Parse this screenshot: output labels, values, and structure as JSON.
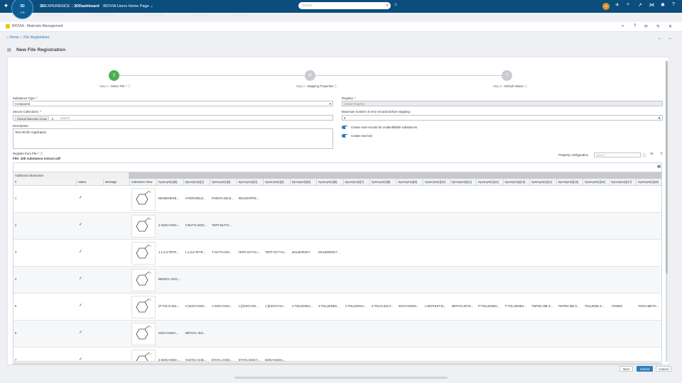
{
  "topbar": {
    "compass_label": "3D",
    "version": "V.R",
    "brand_prefix": "3D",
    "brand_experience": "EXPERIENCE",
    "brand_sep": "|",
    "brand_app": "3DDashboard",
    "dashboard_title": "BIOVIA Users Home Page",
    "search_placeholder": "Search",
    "avatar_initials": "JK",
    "ghost_tabs": [
      "BIOVIA Materials",
      "Getting Started",
      "Sample Data",
      "My Apps",
      "Favorites"
    ]
  },
  "app": {
    "title": "BIOVIA - Materials Management"
  },
  "breadcrumb": {
    "home": "Home",
    "sep": "›",
    "current": "File Registration"
  },
  "page": {
    "title": "New File Registration"
  },
  "steps": [
    {
      "num": "Step 1",
      "label": "Select File *",
      "icon": "file-icon",
      "state": "active"
    },
    {
      "num": "Step 2",
      "label": "Mapping Properties",
      "icon": "mapping-icon",
      "state": "pending"
    },
    {
      "num": "Step 3",
      "label": "Default Values",
      "icon": "default-values-icon",
      "state": "pending"
    }
  ],
  "form": {
    "substance_type_label": "Substance Type:",
    "substance_type_value": "Compound",
    "secure_collections_label": "Secure Collections:",
    "secure_collection_chip": "Default Materials Group",
    "secure_collection_search": "Search",
    "description_label": "Description:",
    "description_value": "Test SD file registration",
    "registry_label": "Registry:",
    "registry_value": "Global Registry",
    "max_errors_label": "Maximum number of error records before stopping:",
    "max_errors_value": "5",
    "toggle1_label": "Create new records for unidentifiable substances",
    "toggle2_label": "Create new lots",
    "register_label": "Register from File",
    "file_label": "File:",
    "file_name": "10k substance extract.sdf",
    "property_config_label": "Property configuration",
    "property_search_placeholder": "Search"
  },
  "grid": {
    "additional_info": "Additional Information",
    "columns": [
      "#",
      "Status",
      "Message",
      "Substance View",
      "Synonym(s)[0]",
      "Synonym(s)[1]",
      "Synonym(s)[2]",
      "Synonym(s)[3]",
      "Synonym(s)[4]",
      "Synonym(s)[5]",
      "Synonym(s)[6]",
      "Synonym(s)[7]",
      "Synonym(s)[8]",
      "Synonym(s)[9]",
      "Synonym(s)[10]",
      "Synonym(s)[11]",
      "Synonym(s)[12]",
      "Synonym(s)[13]",
      "Synonym(s)[14]",
      "Synonym(s)[15]",
      "Synonym(s)[16]",
      "Synonym(s)[17]",
      "Synonym(s)[18]"
    ],
    "rows": [
      {
        "num": "1",
        "status": "✓",
        "synonyms": [
          "BENZENESE...",
          "HYDROSELE...",
          "PHENYLSELE...",
          "SELENOPHE..."
        ]
      },
      {
        "num": "2",
        "status": "✓",
        "synonyms": [
          "2-ISOCYANO-...",
          "T-BUTYLISOC...",
          "TERT-BUTYL..."
        ]
      },
      {
        "num": "3",
        "status": "✓",
        "synonyms": [
          "1,1,3,3-TETR...",
          "1,1,3,3-TETR...",
          "T-OCTYLISO...",
          "TERT-OCTYLI...",
          "TERT-OCTYLI...",
          "WALBORSKY",
          "WALBORSKY'..."
        ]
      },
      {
        "num": "4",
        "status": "✓",
        "synonyms": [
          "BENZYL ISOC..."
        ]
      },
      {
        "num": "5",
        "status": "✓",
        "synonyms": [
          "(P-TOLYLSUL...",
          "1-(ISOCYANO...",
          "1-ISOCYANO...",
          "1-[(ISOCYAN...",
          "1-[(ISOCYAN...",
          "4-TOLUENES...",
          "4-TOLUENES...",
          "4-TOLUENSU...",
          "4-TOLYLSULF...",
          "ISOCYANOM...",
          "LABOTEST-B...",
          "METHYLIDYN...",
          "P-TOLUENES...",
          "P-TOLUENES...",
          "TIMTEC-BB S...",
          "TIMTEC-BB S...",
          "TOLUENE-4-...",
          "TOSMIC",
          "TOSYLMETH..."
        ]
      },
      {
        "num": "6",
        "status": "✓",
        "synonyms": [
          "ISOCYANOA...",
          "METHYL ISO..."
        ]
      },
      {
        "num": "7",
        "status": "✓",
        "synonyms": [
          "2-ISOCYANO-...",
          "ACETIC ACID...",
          "ETHYL 2-ISO...",
          "ETHYL ISOCY...",
          "ISOCYANOA..."
        ]
      }
    ]
  },
  "buttons": {
    "next": "Next",
    "submit": "Submit",
    "cancel": "Cancel"
  },
  "colors": {
    "topbar": "#0b4d7c",
    "accent": "#2f7cb8",
    "step_done": "#4caf50"
  }
}
